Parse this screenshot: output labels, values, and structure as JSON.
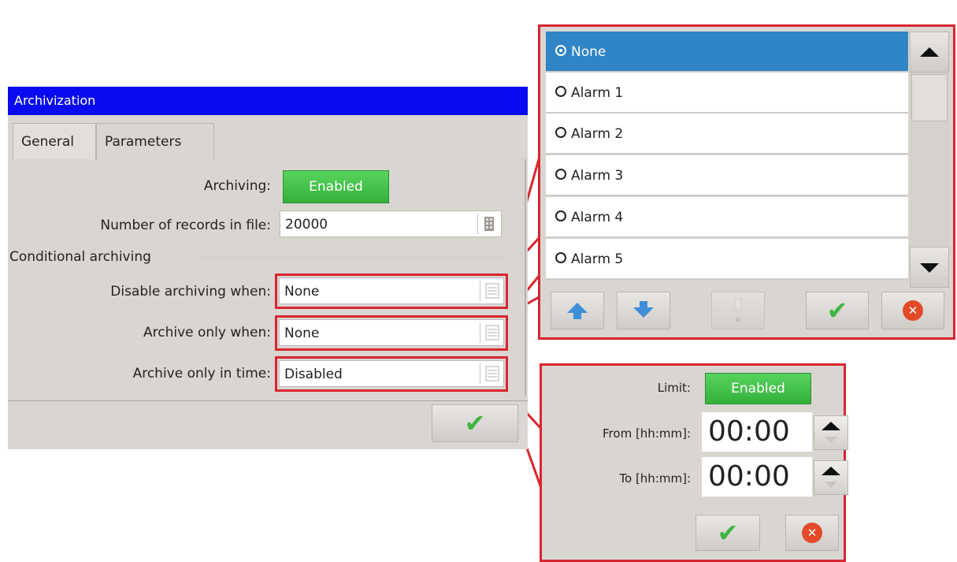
{
  "dialog": {
    "title": "Archivization",
    "tabs": [
      "General",
      "Parameters"
    ],
    "archiving_label": "Archiving:",
    "archiving_value": "Enabled",
    "records_label": "Number of records in file:",
    "records_value": "20000",
    "section_label": "Conditional archiving",
    "disable_label": "Disable archiving when:",
    "disable_value": "None",
    "only_when_label": "Archive only when:",
    "only_when_value": "None",
    "only_time_label": "Archive only in time:",
    "only_time_value": "Disabled"
  },
  "popup": {
    "items": [
      "None",
      "Alarm 1",
      "Alarm 2",
      "Alarm 3",
      "Alarm 4",
      "Alarm 5"
    ],
    "selected": "None"
  },
  "limit_panel": {
    "limit_label": "Limit:",
    "limit_value": "Enabled",
    "from_label": "From [hh:mm]:",
    "from_value": "00:00",
    "to_label": "To [hh:mm]:",
    "to_value": "00:00"
  },
  "colors": {
    "highlight_red": "#d8262f",
    "title_blue": "#0a0af0",
    "selected_blue": "#2f85c5",
    "enabled_green": "#3fb53f"
  }
}
